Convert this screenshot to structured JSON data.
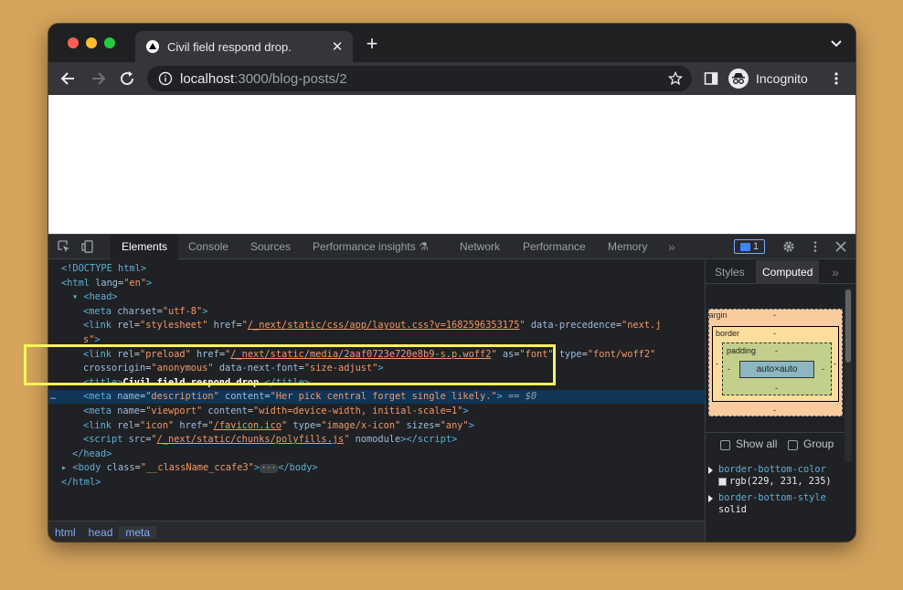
{
  "browser": {
    "tab_title": "Civil field respond drop.",
    "url_host": "localhost",
    "url_path": ":3000/blog-posts/2",
    "profile_label": "Incognito",
    "traffic_lights": [
      "#ff5f57",
      "#febc2e",
      "#28c840"
    ]
  },
  "devtools": {
    "tabs": [
      "Elements",
      "Console",
      "Sources",
      "Performance insights",
      "Network",
      "Performance",
      "Memory"
    ],
    "active_tab": "Elements",
    "more_tabs": "»",
    "issues_count": "1",
    "dom_lines": [
      {
        "indent": 0,
        "html": "<span class=\"tag\">&lt;!DOCTYPE html&gt;</span>"
      },
      {
        "indent": 0,
        "html": "<span class=\"tag\">&lt;html</span> <span class=\"an\">lang</span>=<span class=\"av\">\"en\"</span><span class=\"tag\">&gt;</span>"
      },
      {
        "indent": 1,
        "html": "<span class=\"tag\">▾ &lt;head&gt;</span>"
      },
      {
        "indent": 2,
        "html": "<span class=\"tag\">&lt;meta</span> <span class=\"an\">charset</span>=<span class=\"av\">\"utf-8\"</span><span class=\"tag\">&gt;</span>"
      },
      {
        "indent": 2,
        "html": "<span class=\"tag\">&lt;link</span> <span class=\"an\">rel</span>=<span class=\"av\">\"stylesheet\"</span> <span class=\"an\">href</span>=<span class=\"av\">\"</span><span class=\"lnk\">/_next/static/css/app/layout.css?v=1682596353175</span><span class=\"av\">\"</span> <span class=\"an\">data-precedence</span>=<span class=\"av\">\"next.j</span>"
      },
      {
        "indent": 2,
        "html": "<span class=\"av\">s\"</span><span class=\"tag\">&gt;</span>"
      },
      {
        "indent": 2,
        "html": "<span class=\"tag\">&lt;link</span> <span class=\"an\">rel</span>=<span class=\"av\">\"preload\"</span> <span class=\"an\">href</span>=<span class=\"av\">\"</span><span class=\"lnk\">/_next/static/media/2aaf0723e720e8b9-s.p.woff2</span><span class=\"av\">\"</span> <span class=\"an\">as</span>=<span class=\"av\">\"font\"</span> <span class=\"an\">type</span>=<span class=\"av\">\"font/woff2\"</span>"
      },
      {
        "indent": 2,
        "html": "<span class=\"an\">crossorigin</span>=<span class=\"av\">\"anonymous\"</span> <span class=\"an\">data-next-font</span>=<span class=\"av\">\"size-adjust\"</span><span class=\"tag\">&gt;</span>"
      },
      {
        "indent": 2,
        "html": "<span class=\"tag\">&lt;title&gt;</span><span class=\"txt\">Civil field respond drop.</span><span class=\"tag\">&lt;/title&gt;</span>"
      },
      {
        "indent": 2,
        "selected": true,
        "html": "<span class=\"tag\">&lt;meta</span> <span class=\"an\">name</span>=<span class=\"av\">\"description\"</span> <span class=\"an\">content</span>=<span class=\"av\">\"Her pick central forget single likely.\"</span><span class=\"tag\">&gt;</span> <span class=\"dim\">== $0</span>"
      },
      {
        "indent": 2,
        "html": "<span class=\"tag\">&lt;meta</span> <span class=\"an\">name</span>=<span class=\"av\">\"viewport\"</span> <span class=\"an\">content</span>=<span class=\"av\">\"width=device-width, initial-scale=1\"</span><span class=\"tag\">&gt;</span>"
      },
      {
        "indent": 2,
        "html": "<span class=\"tag\">&lt;link</span> <span class=\"an\">rel</span>=<span class=\"av\">\"icon\"</span> <span class=\"an\">href</span>=<span class=\"av\">\"</span><span class=\"lnk\">/favicon.ico</span><span class=\"av\">\"</span> <span class=\"an\">type</span>=<span class=\"av\">\"image/x-icon\"</span> <span class=\"an\">sizes</span>=<span class=\"av\">\"any\"</span><span class=\"tag\">&gt;</span>"
      },
      {
        "indent": 2,
        "html": "<span class=\"tag\">&lt;script</span> <span class=\"an\">src</span>=<span class=\"av\">\"</span><span class=\"lnk\">/_next/static/chunks/polyfills.js</span><span class=\"av\">\"</span> <span class=\"an\">nomodule</span><span class=\"tag\">&gt;&lt;/script&gt;</span>"
      },
      {
        "indent": 1,
        "html": "<span class=\"tag\">&lt;/head&gt;</span>"
      },
      {
        "indent": 0,
        "html": "<span class=\"tag\">▸ &lt;body</span> <span class=\"an\">class</span>=<span class=\"av\">\"__className_ccafe3\"</span><span class=\"tag\">&gt;</span><span class=\"dots\">···</span><span class=\"tag\">&lt;/body&gt;</span>"
      },
      {
        "indent": 0,
        "html": "<span class=\"tag\">&lt;/html&gt;</span>"
      }
    ],
    "breadcrumbs": [
      "html",
      "head",
      "meta"
    ],
    "sidebar": {
      "tabs": [
        "Styles",
        "Computed"
      ],
      "active_tab": "Computed",
      "more": "»",
      "box_model": {
        "margin_label": "margin",
        "border_label": "border",
        "padding_label": "padding",
        "content_size": "auto×auto",
        "dash": "-"
      },
      "show_all_label": "Show all",
      "group_label": "Group",
      "properties": [
        {
          "name": "border-bottom-color",
          "value": "rgb(229, 231, 235)",
          "swatch": "#e5e7eb"
        },
        {
          "name": "border-bottom-style",
          "value": "solid"
        }
      ]
    }
  }
}
